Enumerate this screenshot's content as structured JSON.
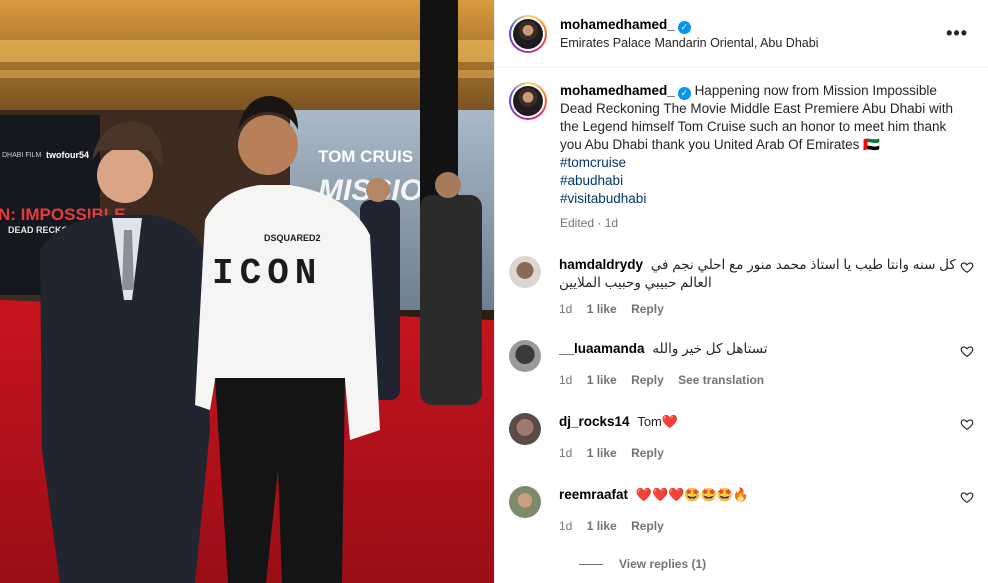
{
  "post": {
    "username": "mohamedhamed_",
    "location": "Emirates Palace Mandarin Oriental, Abu Dhabi",
    "more_icon": "more-options-icon",
    "verified_icon": "verified-badge-icon",
    "photo_text": {
      "banner_title": "TOM CRUIS",
      "banner_sub": "MISSIO",
      "poster_title": "N: IMPOSSIBLE",
      "poster_sub": "DEAD RECKONING",
      "shirt_brand": "DSQUARED2",
      "shirt_word": "ICON",
      "logo_left": "DHABI FILM",
      "logo_right": "twofour54"
    }
  },
  "caption": {
    "username": "mohamedhamed_",
    "text": "Happening now from Mission Impossible Dead Reckoning The Movie Middle East Premiere Abu Dhabi with the Legend himself Tom Cruise such an honor to meet him thank you Abu Dhabi thank you United Arab Of Emirates 🇦🇪",
    "hashtags": [
      "#tomcruise",
      "#abudhabi",
      "#visitabudhabi"
    ],
    "edited": "Edited · 1d"
  },
  "comments": [
    {
      "username": "hamdaldrydy",
      "text": "كل سنه وانتا طيب يا استاذ محمد منور مع احلي نجم في العالم حبيبي وحبيب الملايين",
      "time": "1d",
      "likes": "1 like",
      "reply": "Reply",
      "translate": ""
    },
    {
      "username": "__luaamanda",
      "text": "تستاهل كل خير والله",
      "time": "1d",
      "likes": "1 like",
      "reply": "Reply",
      "translate": "See translation"
    },
    {
      "username": "dj_rocks14",
      "text": "Tom❤️",
      "time": "1d",
      "likes": "1 like",
      "reply": "Reply",
      "translate": ""
    },
    {
      "username": "reemraafat",
      "text": "❤️❤️❤️🤩🤩🤩🔥",
      "time": "1d",
      "likes": "1 like",
      "reply": "Reply",
      "translate": "",
      "view_replies": "View replies (1)"
    }
  ],
  "colors": {
    "verified": "#0095f6",
    "hashtag": "#00376b",
    "muted": "#737373",
    "carpet": "#b3121b"
  }
}
